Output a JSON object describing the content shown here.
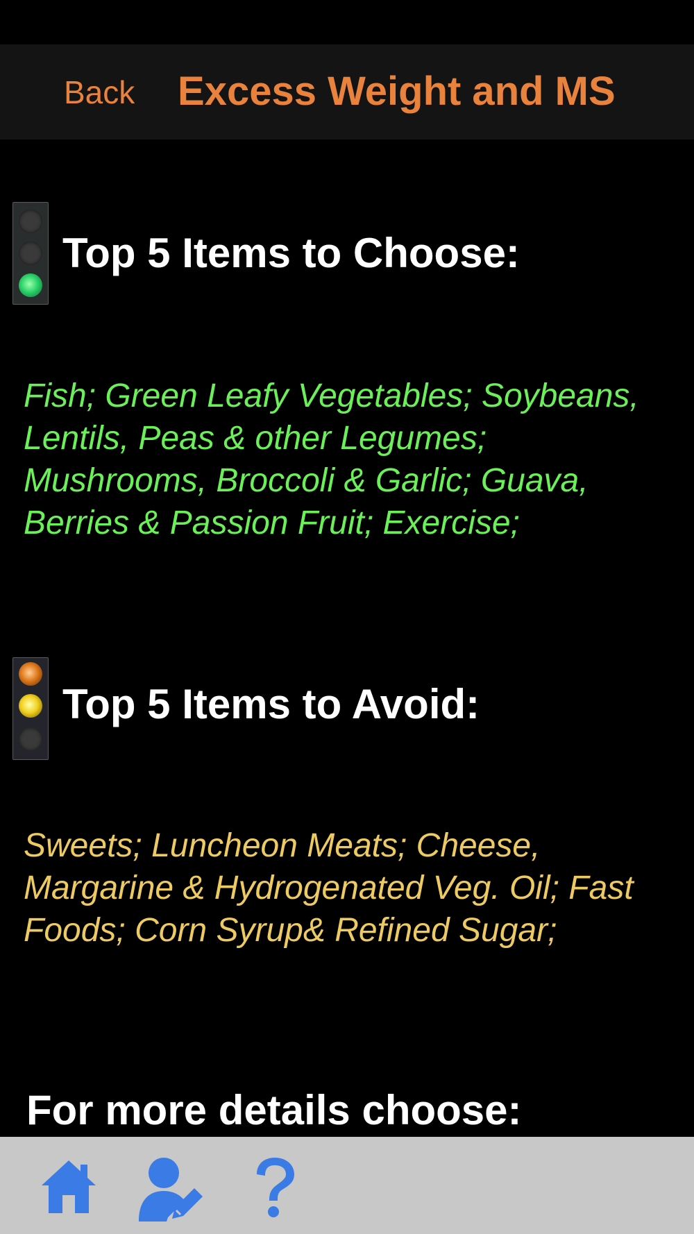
{
  "nav": {
    "back_label": "Back",
    "title": "Excess Weight and MS"
  },
  "choose": {
    "heading": "Top 5 Items to Choose:",
    "items_text": "Fish; Green Leafy Vegetables; Soybeans, Lentils, Peas & other Legumes; Mushrooms, Broccoli & Garlic; Guava, Berries & Passion Fruit; Exercise;",
    "icon": "green-traffic-light-icon"
  },
  "avoid": {
    "heading": "Top 5 Items to Avoid:",
    "items_text": "Sweets; Luncheon Meats; Cheese, Margarine & Hydrogenated Veg. Oil; Fast Foods; Corn Syrup& Refined Sugar;",
    "icon": "yellow-traffic-light-icon"
  },
  "more_details": "For more details choose:",
  "tab_bar": {
    "items": [
      {
        "icon": "home-icon"
      },
      {
        "icon": "user-edit-icon"
      },
      {
        "icon": "question-mark-icon"
      }
    ]
  },
  "colors": {
    "accent": "#E8823C",
    "choose": "#6CF05A",
    "avoid": "#EECB62",
    "tab_icon": "#3B7BE6"
  }
}
